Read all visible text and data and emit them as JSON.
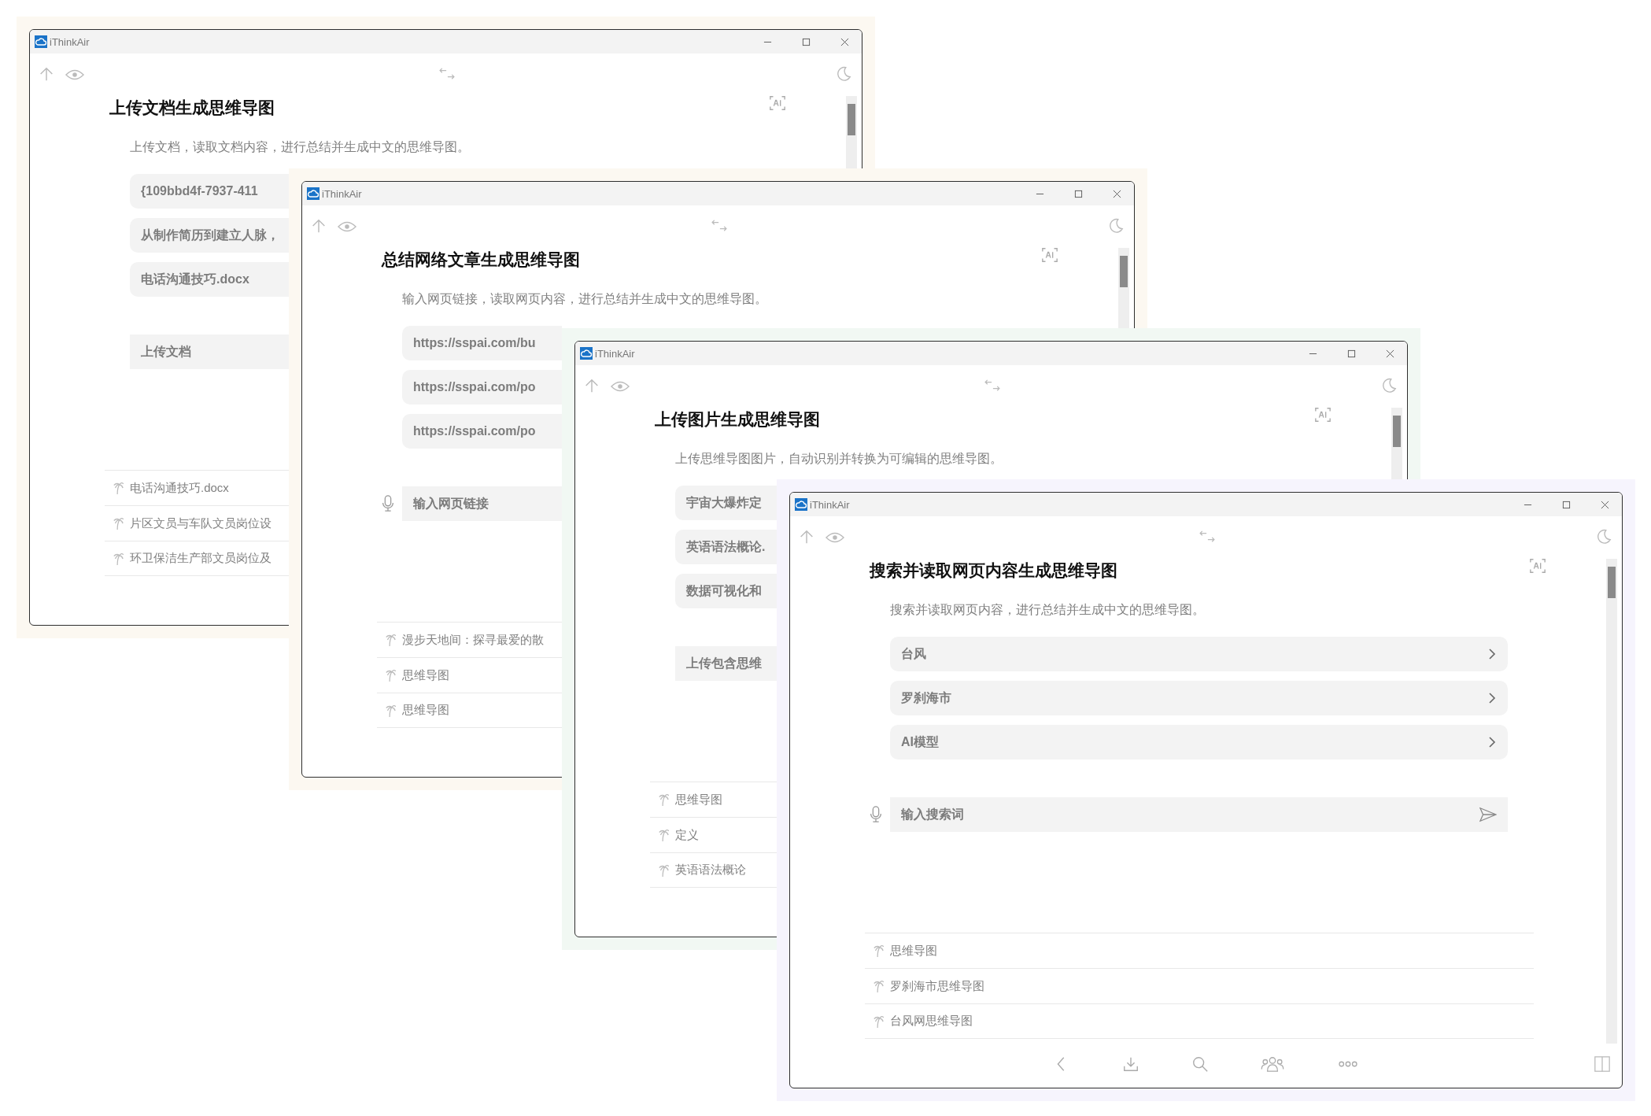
{
  "windows": [
    {
      "title": "iThinkAir",
      "heading": "上传文档生成思维导图",
      "description": "上传文档，读取文档内容，进行总结并生成中文的思维导图。",
      "items": [
        {
          "label": "{109bbd4f-7937-411"
        },
        {
          "label": "从制作简历到建立人脉，"
        },
        {
          "label": "电话沟通技巧.docx"
        }
      ],
      "action": {
        "kind": "button",
        "label": "上传文档"
      },
      "history": [
        "电话沟通技巧.docx",
        "片区文员与车队文员岗位设",
        "环卫保洁生产部文员岗位及"
      ]
    },
    {
      "title": "iThinkAir",
      "heading": "总结网络文章生成思维导图",
      "description": "输入网页链接，读取网页内容，进行总结并生成中文的思维导图。",
      "items": [
        {
          "label": "https://sspai.com/bu"
        },
        {
          "label": "https://sspai.com/po"
        },
        {
          "label": "https://sspai.com/po"
        }
      ],
      "action": {
        "kind": "field",
        "placeholder": "输入网页链接"
      },
      "history": [
        "漫步天地间：探寻最爱的散",
        "思维导图",
        "思维导图"
      ]
    },
    {
      "title": "iThinkAir",
      "heading": "上传图片生成思维导图",
      "description": "上传思维导图图片，自动识别并转换为可编辑的思维导图。",
      "items": [
        {
          "label": "宇宙大爆炸定"
        },
        {
          "label": "英语语法概论."
        },
        {
          "label": "数据可视化和"
        }
      ],
      "action": {
        "kind": "button",
        "label": "上传包含思维"
      },
      "history": [
        "思维导图",
        "定义",
        "英语语法概论"
      ]
    },
    {
      "title": "iThinkAir",
      "heading": "搜索并读取网页内容生成思维导图",
      "description": "搜索并读取网页内容，进行总结并生成中文的思维导图。",
      "items": [
        {
          "label": "台风"
        },
        {
          "label": "罗刹海市"
        },
        {
          "label": "AI模型"
        }
      ],
      "action": {
        "kind": "field",
        "placeholder": "输入搜索词"
      },
      "history": [
        "思维导图",
        "罗刹海市思维导图",
        "台风网思维导图"
      ]
    }
  ]
}
